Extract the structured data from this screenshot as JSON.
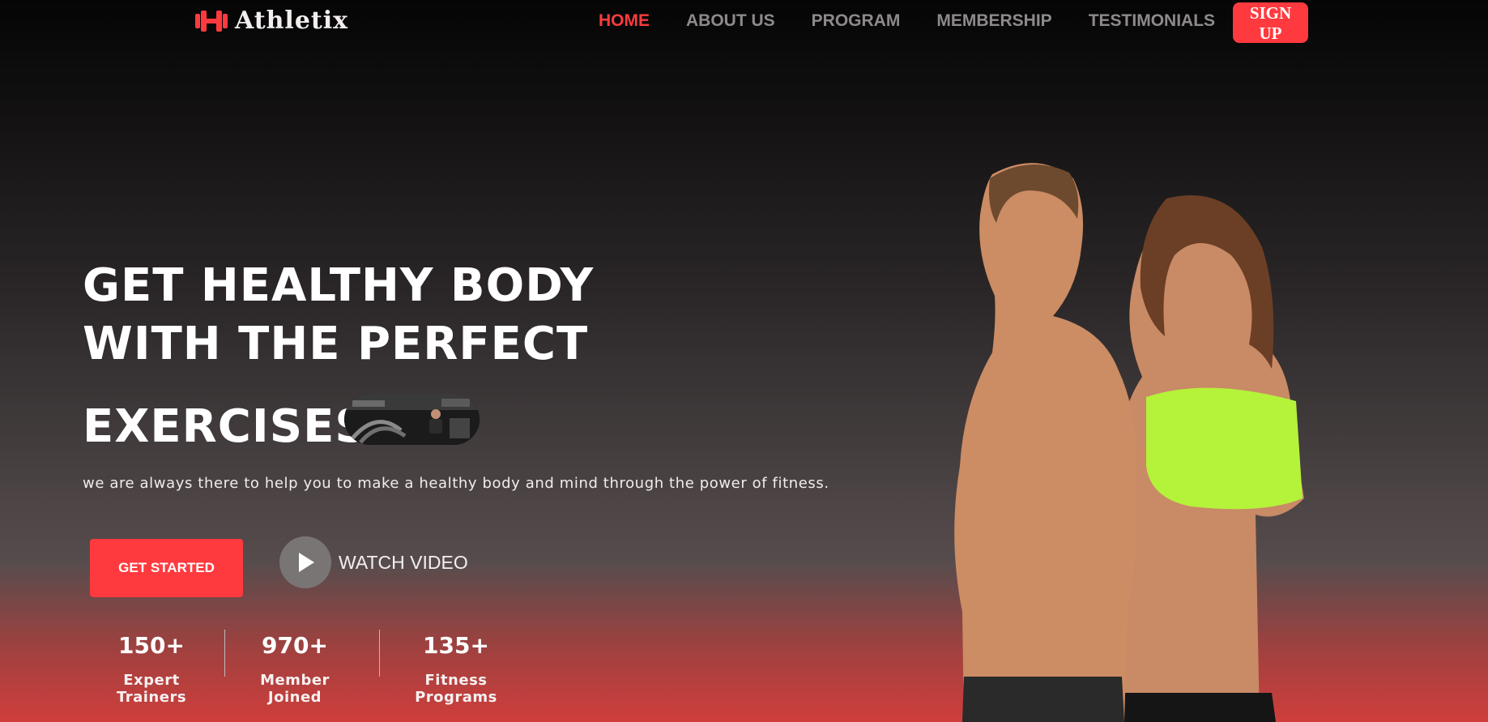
{
  "brand": {
    "name": "Athletix",
    "color": "#ff3a3f"
  },
  "nav": {
    "items": [
      {
        "label": "HOME",
        "active": true
      },
      {
        "label": "ABOUT US",
        "active": false
      },
      {
        "label": "PROGRAM",
        "active": false
      },
      {
        "label": "MEMBERSHIP",
        "active": false
      },
      {
        "label": "TESTIMONIALS",
        "active": false
      }
    ],
    "signup_label": "SIGN UP"
  },
  "hero": {
    "line1": "GET HEALTHY BODY",
    "line2": "WITH THE PERFECT",
    "line3": "EXERCISES",
    "subtitle": "we are always there to help you to make a healthy body and mind through the power of fitness.",
    "cta_label": "GET STARTED",
    "video_label": "WATCH VIDEO"
  },
  "stats": [
    {
      "value": "150+",
      "label": "Expert Trainers"
    },
    {
      "value": "970+",
      "label": "Member Joined"
    },
    {
      "value": "135+",
      "label": "Fitness Programs"
    }
  ]
}
